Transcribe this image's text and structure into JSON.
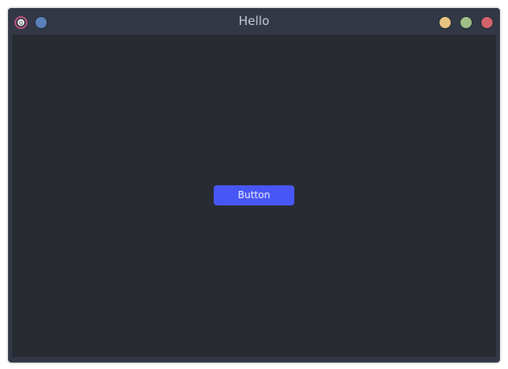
{
  "window": {
    "title": "Hello",
    "colors": {
      "titlebar": "#323845",
      "content_background": "#282b31",
      "minimize": "#e6c382",
      "maximize": "#9fbf86",
      "close": "#d1636b",
      "pin": "#5b7fb8"
    },
    "icons": {
      "app": "qt-app-icon",
      "pin": "pin-icon",
      "minimize": "minimize-icon",
      "maximize": "maximize-icon",
      "close": "close-icon"
    }
  },
  "content": {
    "button_label": "Button",
    "button_color": "#4756f5"
  }
}
